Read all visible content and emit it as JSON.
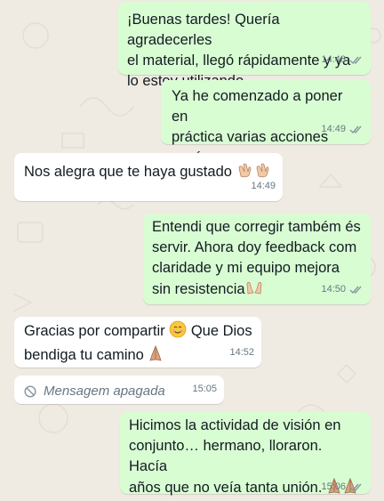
{
  "colors": {
    "chat_background": "#efeae2",
    "outgoing_bubble": "#d9fdd3",
    "incoming_bubble": "#ffffff",
    "meta_text": "#667781",
    "read_ticks": "#8696a0"
  },
  "messages": [
    {
      "direction": "outgoing",
      "text": "¡Buenas tardes! Quería agradecerles\nel material, llegó rápidamente y ya\nlo estoy utilizando.",
      "time": "14:48",
      "status": "double-check"
    },
    {
      "direction": "outgoing",
      "text": "Ya he comenzado a poner en\npráctica varias acciones aquí.",
      "time": "14:49",
      "status": "double-check"
    },
    {
      "direction": "incoming",
      "text": "Nos alegra que te haya gustado",
      "emoji": [
        "clapping-hands-emoji",
        "clapping-hands-emoji"
      ],
      "time": "14:49"
    },
    {
      "direction": "outgoing",
      "text": "Entendi que corregir também és\nservir. Ahora doy feedback com\nclaridade y mi equipo mejora\nsin resistencia",
      "emoji": [
        "raising-hands-emoji"
      ],
      "time": "14:50",
      "status": "double-check"
    },
    {
      "direction": "incoming",
      "text_line1": "Gracias por compartir",
      "text_line1_after": "Que Dios",
      "text_line2": "bendiga tu camino",
      "emoji": [
        "smiling-face-emoji",
        "folded-hands-emoji"
      ],
      "time": "14:52"
    },
    {
      "direction": "incoming",
      "deleted": true,
      "text": "Mensagem apagada",
      "icon": "deleted-message-icon",
      "time": "15:05"
    },
    {
      "direction": "outgoing",
      "text": "Hicimos la actividad de visión en\nconjunto… hermano, lloraron. Hacía\naños que no veía tanta unión.",
      "emoji": [
        "folded-hands-emoji",
        "folded-hands-emoji"
      ],
      "time": "15:06",
      "status": "double-check"
    }
  ]
}
